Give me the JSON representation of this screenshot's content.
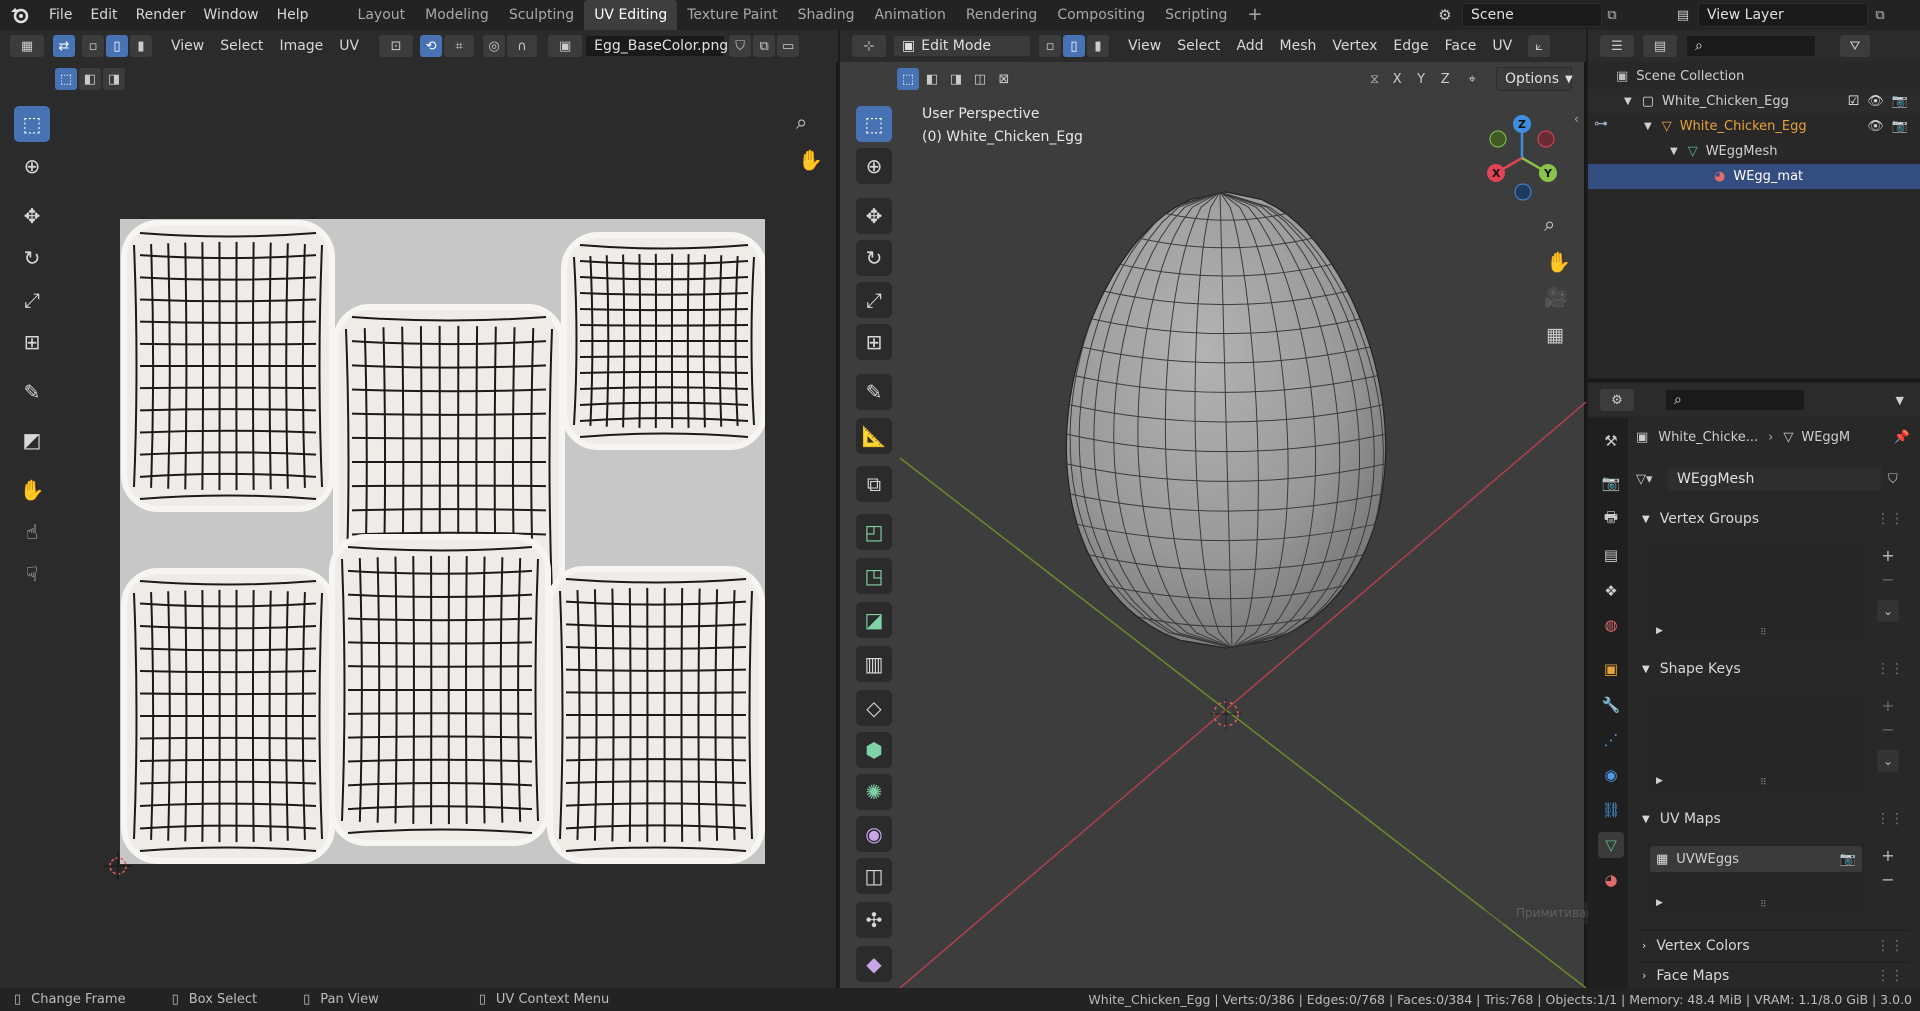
{
  "topbar": {
    "menus": [
      "File",
      "Edit",
      "Render",
      "Window",
      "Help"
    ],
    "workspaces": [
      "Layout",
      "Modeling",
      "Sculpting",
      "UV Editing",
      "Texture Paint",
      "Shading",
      "Animation",
      "Rendering",
      "Compositing",
      "Scripting"
    ],
    "active_workspace": "UV Editing",
    "add_tab": "+",
    "scene_label": "Scene",
    "view_layer_label": "View Layer"
  },
  "uv_editor": {
    "header_menus": [
      "View",
      "Select",
      "Image",
      "UV"
    ],
    "image_name": "Egg_BaseColor.png"
  },
  "viewport": {
    "mode": "Edit Mode",
    "header_menus": [
      "View",
      "Select",
      "Add",
      "Mesh",
      "Vertex",
      "Edge",
      "Face",
      "UV"
    ],
    "axes": [
      "X",
      "Y",
      "Z"
    ],
    "options_label": "Options",
    "overlay_line1": "User Perspective",
    "overlay_line2": "(0) White_Chicken_Egg",
    "gizmo": {
      "x": "X",
      "y": "Y",
      "z": "Z"
    },
    "faded_tooltip": "Примитивами"
  },
  "outliner": {
    "scene_collection": "Scene Collection",
    "items": [
      {
        "label": "White_Chicken_Egg",
        "level": 1,
        "kind": "collection"
      },
      {
        "label": "White_Chicken_Egg",
        "level": 2,
        "kind": "object"
      },
      {
        "label": "WEggMesh",
        "level": 3,
        "kind": "mesh"
      },
      {
        "label": "WEgg_mat",
        "level": 4,
        "kind": "material"
      }
    ]
  },
  "properties": {
    "breadcrumb_object": "White_Chicke...",
    "breadcrumb_data": "WEggM",
    "mesh_name": "WEggMesh",
    "sections": {
      "vertex_groups": "Vertex Groups",
      "shape_keys": "Shape Keys",
      "uv_maps": "UV Maps",
      "vertex_colors": "Vertex Colors",
      "face_maps": "Face Maps"
    },
    "uv_map_item": "UVWEggs"
  },
  "statusbar": {
    "hint1": "Change Frame",
    "hint2": "Box Select",
    "hint3": "Pan View",
    "hint4": "UV Context Menu",
    "stats": "White_Chicken_Egg | Verts:0/386 | Edges:0/768 | Faces:0/384 | Tris:768 | Objects:1/1 | Memory: 48.4 MiB | VRAM: 1.1/8.0 GiB | 3.0.0"
  },
  "colors": {
    "accent": "#4772b3",
    "active_tab": "#3e3e3e",
    "selection_row": "#334d80",
    "object_orange": "#e8a23c",
    "mesh_green": "#5bb98b",
    "axis_x": "#e04256",
    "axis_y": "#8bc34a",
    "axis_z": "#3f8fe0"
  }
}
